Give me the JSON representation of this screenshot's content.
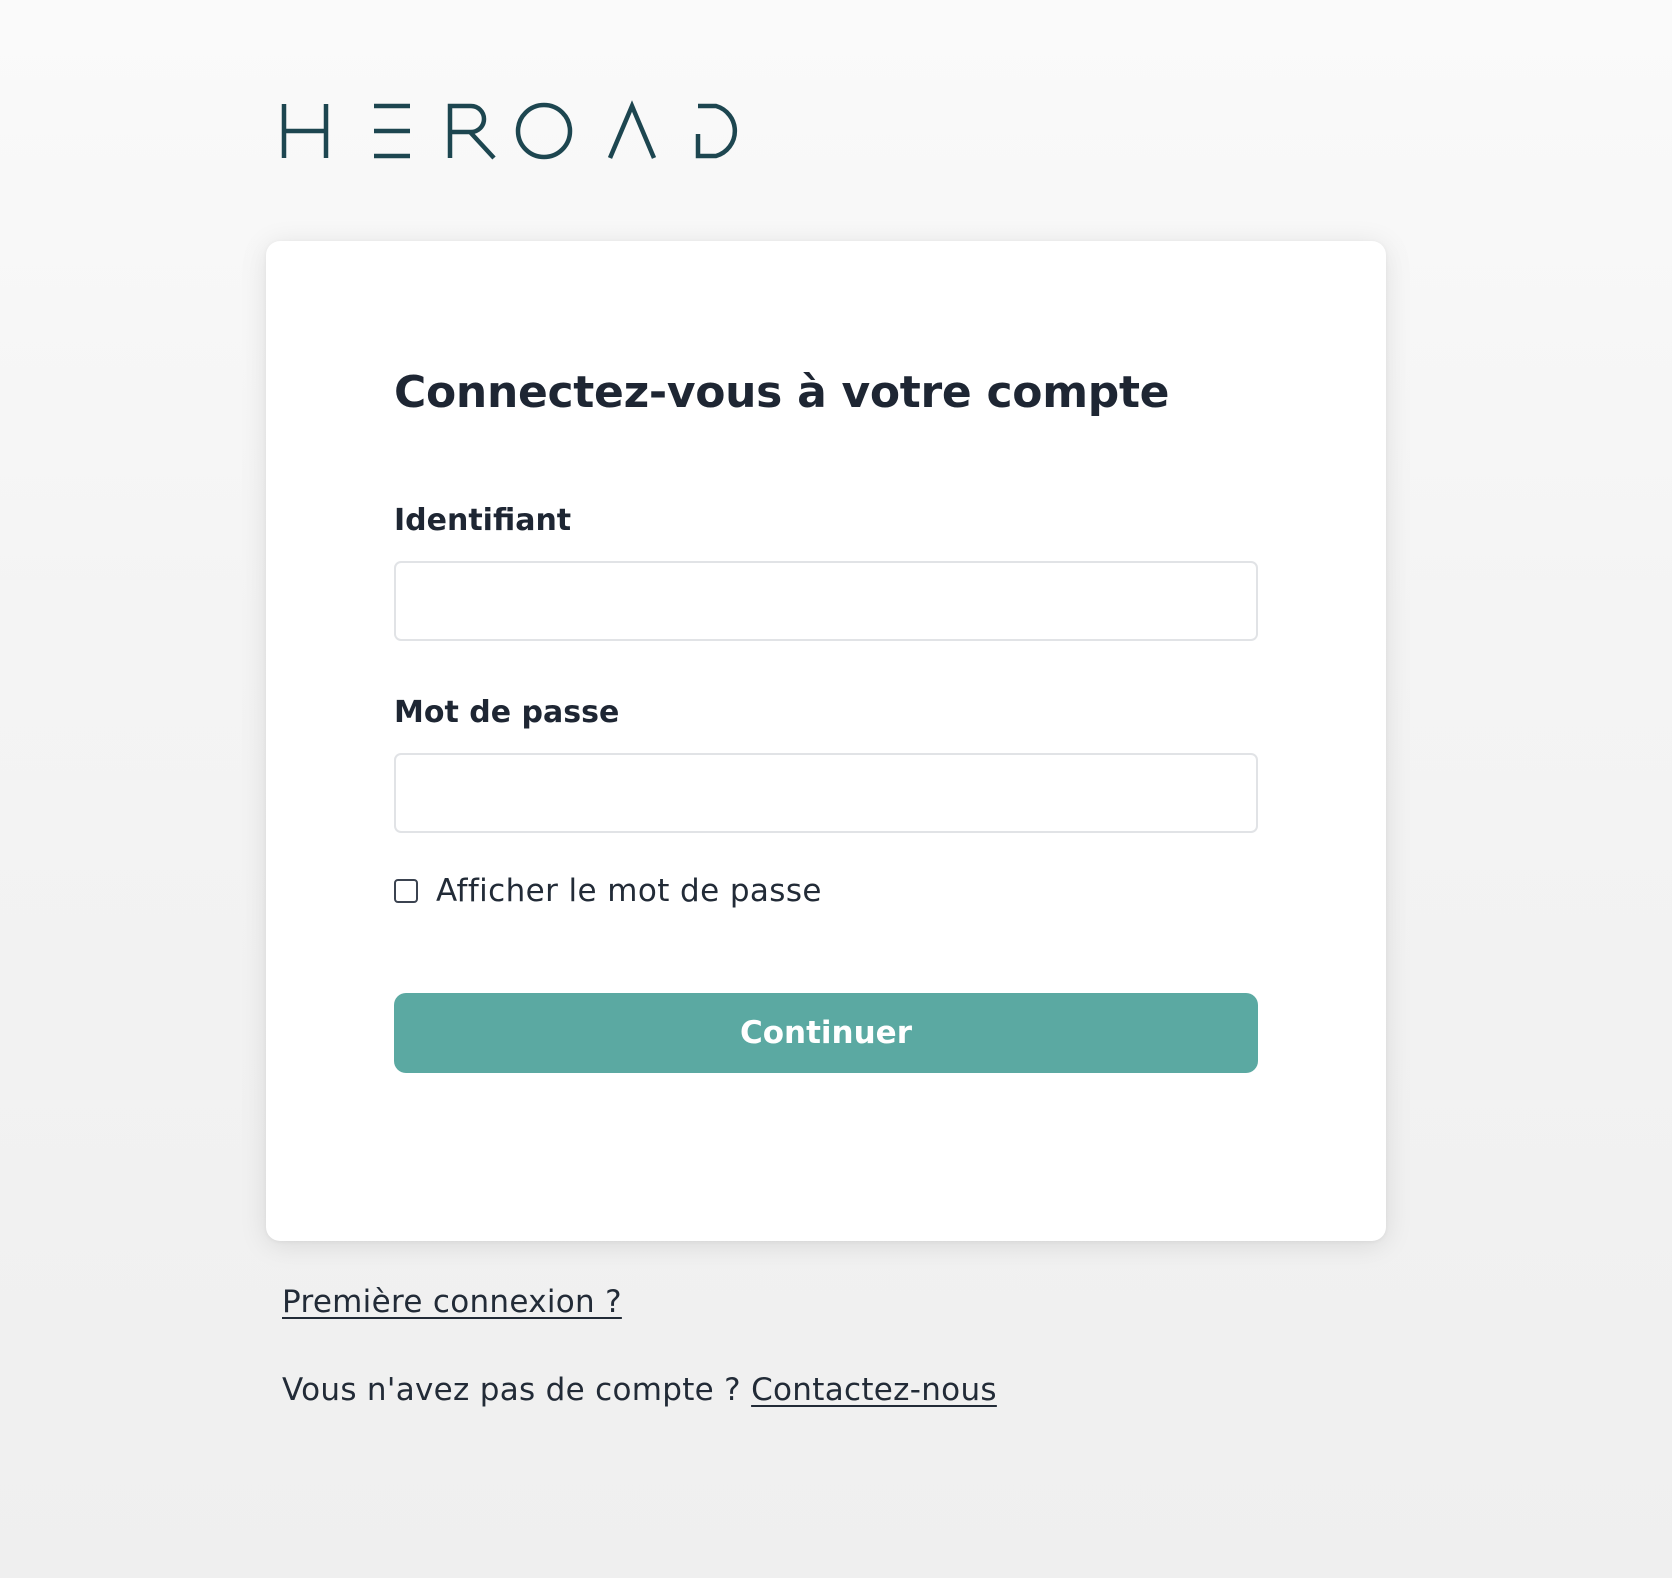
{
  "brand": {
    "logo_text": "HEROAD",
    "logo_color": "#1d4650"
  },
  "colors": {
    "primary_button": "#5ba9a2",
    "text": "#1e2633",
    "input_border": "#e1e3e6"
  },
  "login": {
    "title": "Connectez-vous à votre compte",
    "username_label": "Identifiant",
    "username_value": "",
    "password_label": "Mot de passe",
    "password_value": "",
    "show_password_label": "Afficher le mot de passe",
    "show_password_checked": false,
    "submit_label": "Continuer"
  },
  "footer": {
    "first_login_link": "Première connexion ?",
    "no_account_text": "Vous n'avez pas de compte ?",
    "contact_link": "Contactez-nous"
  }
}
